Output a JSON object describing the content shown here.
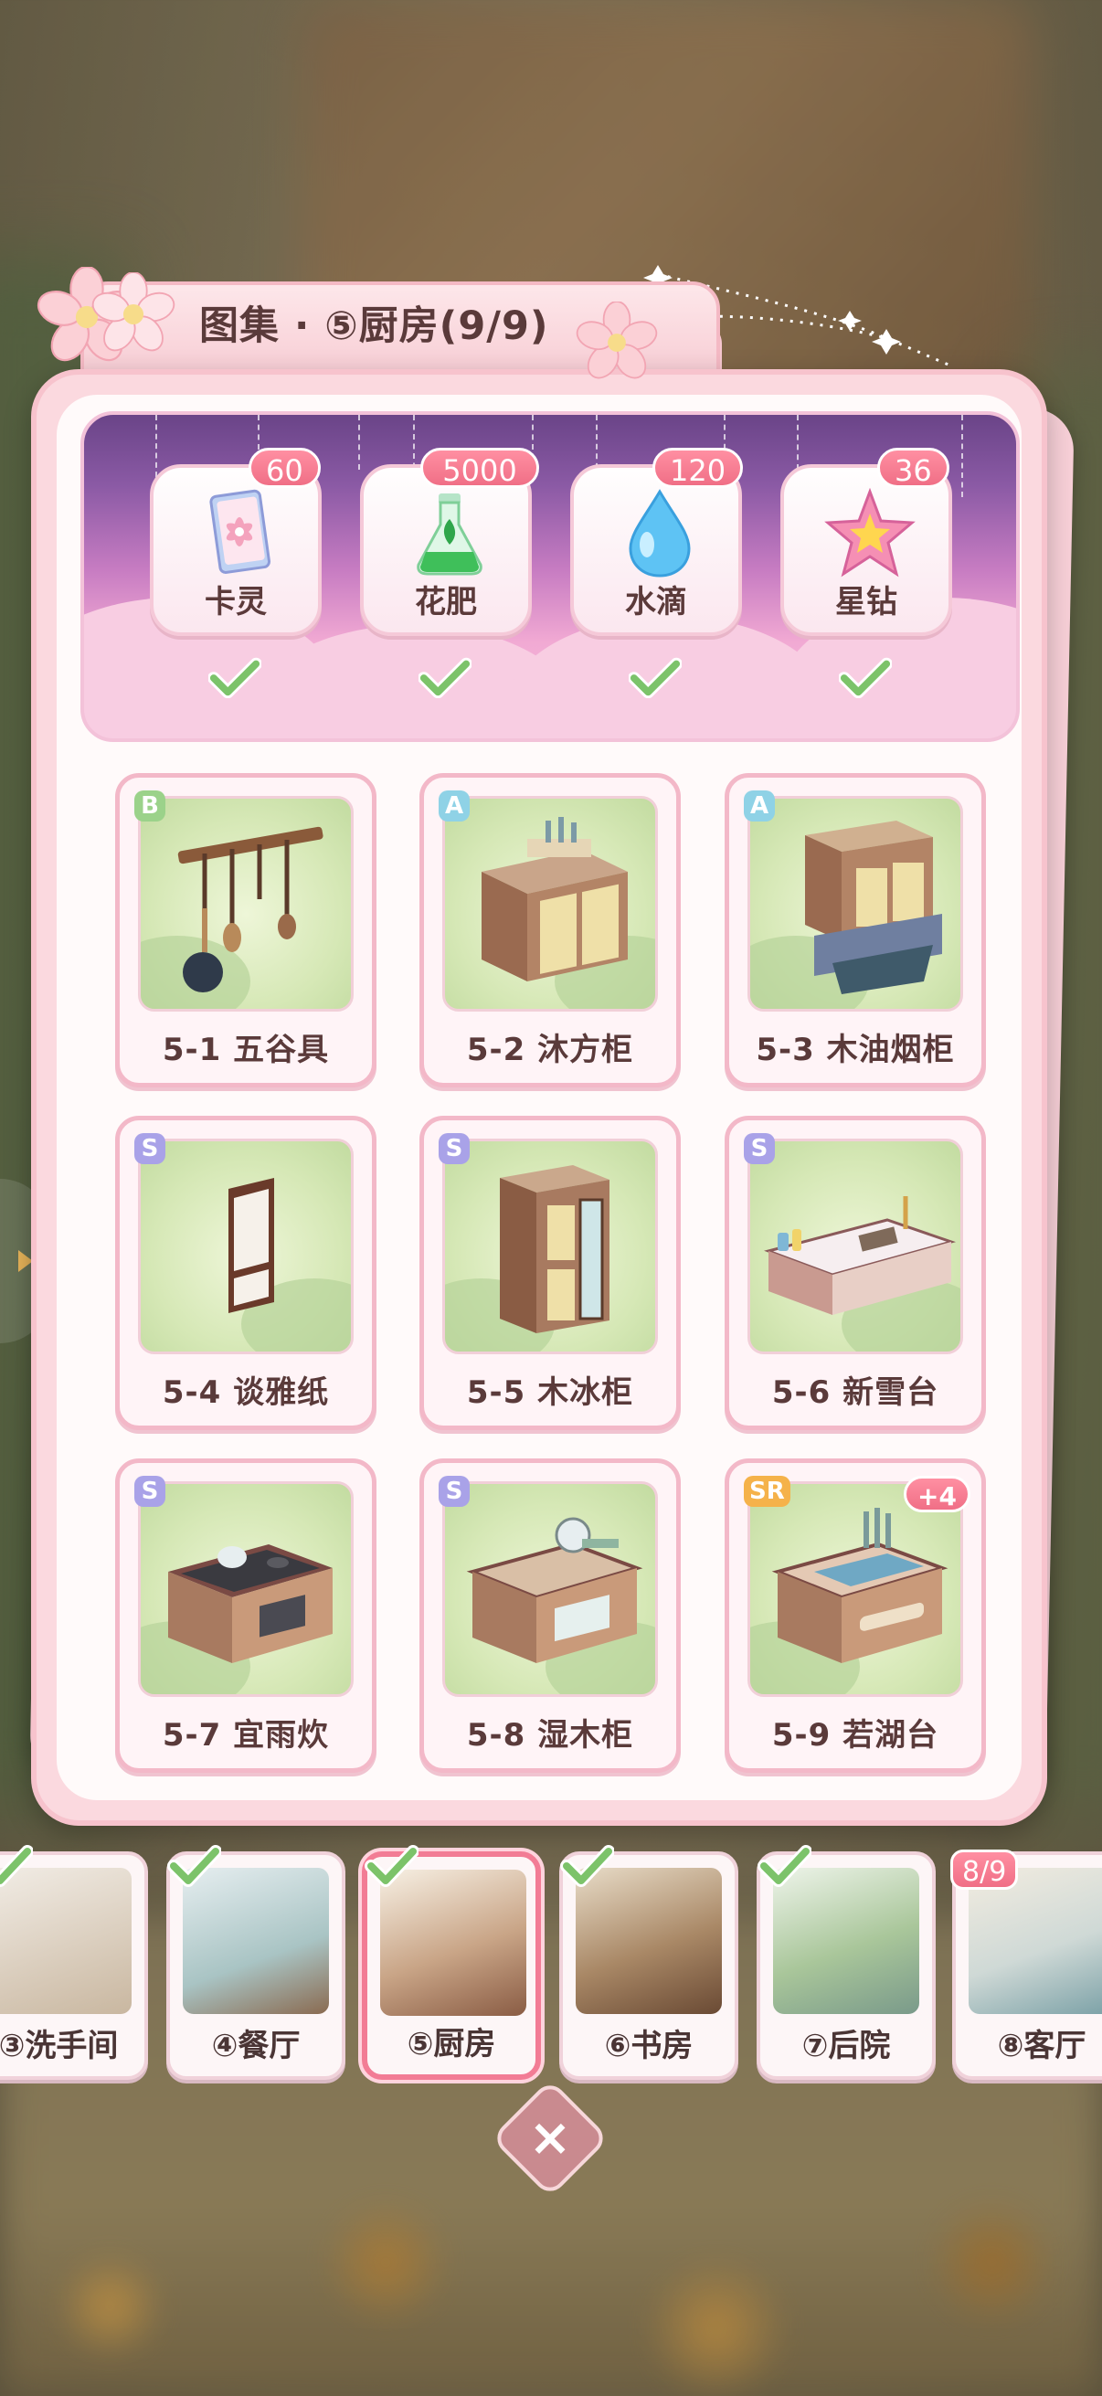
{
  "title": "图集 · ⑤厨房(9/9)",
  "colors": {
    "accent_pink": "#f06f86",
    "panel_pink": "#fbd9df",
    "banner_purple": "#6a4488",
    "check_green": "#7cc36a"
  },
  "rewards": [
    {
      "label": "卡灵",
      "count": "60",
      "icon": "card-spirit-icon",
      "claimed": true
    },
    {
      "label": "花肥",
      "count": "5000",
      "icon": "fertilizer-flask-icon",
      "claimed": true
    },
    {
      "label": "水滴",
      "count": "120",
      "icon": "water-drop-icon",
      "claimed": true
    },
    {
      "label": "星钻",
      "count": "36",
      "icon": "star-diamond-icon",
      "claimed": true
    }
  ],
  "items": [
    {
      "name": "5-1 五谷具",
      "grade": "B",
      "icon": "utensil-rack-icon"
    },
    {
      "name": "5-2 沐方柜",
      "grade": "A",
      "icon": "cabinet-icon"
    },
    {
      "name": "5-3 木油烟柜",
      "grade": "A",
      "icon": "range-hood-cabinet-icon"
    },
    {
      "name": "5-4 谈雅纸",
      "grade": "S",
      "icon": "paper-scroll-icon"
    },
    {
      "name": "5-5 木冰柜",
      "grade": "S",
      "icon": "fridge-icon"
    },
    {
      "name": "5-6 新雪台",
      "grade": "S",
      "icon": "counter-icon"
    },
    {
      "name": "5-7 宜雨炊",
      "grade": "S",
      "icon": "stove-icon"
    },
    {
      "name": "5-8 湿木柜",
      "grade": "S",
      "icon": "dish-cabinet-icon"
    },
    {
      "name": "5-9 若湖台",
      "grade": "SR",
      "icon": "sink-counter-icon",
      "extra": "+4"
    }
  ],
  "rooms": [
    {
      "label": "③洗手间",
      "completed": true
    },
    {
      "label": "④餐厅",
      "completed": true
    },
    {
      "label": "⑤厨房",
      "completed": true,
      "active": true
    },
    {
      "label": "⑥书房",
      "completed": true
    },
    {
      "label": "⑦后院",
      "completed": true
    },
    {
      "label": "⑧客厅",
      "completed": false,
      "progress": "8/9"
    }
  ],
  "close_label": "×"
}
